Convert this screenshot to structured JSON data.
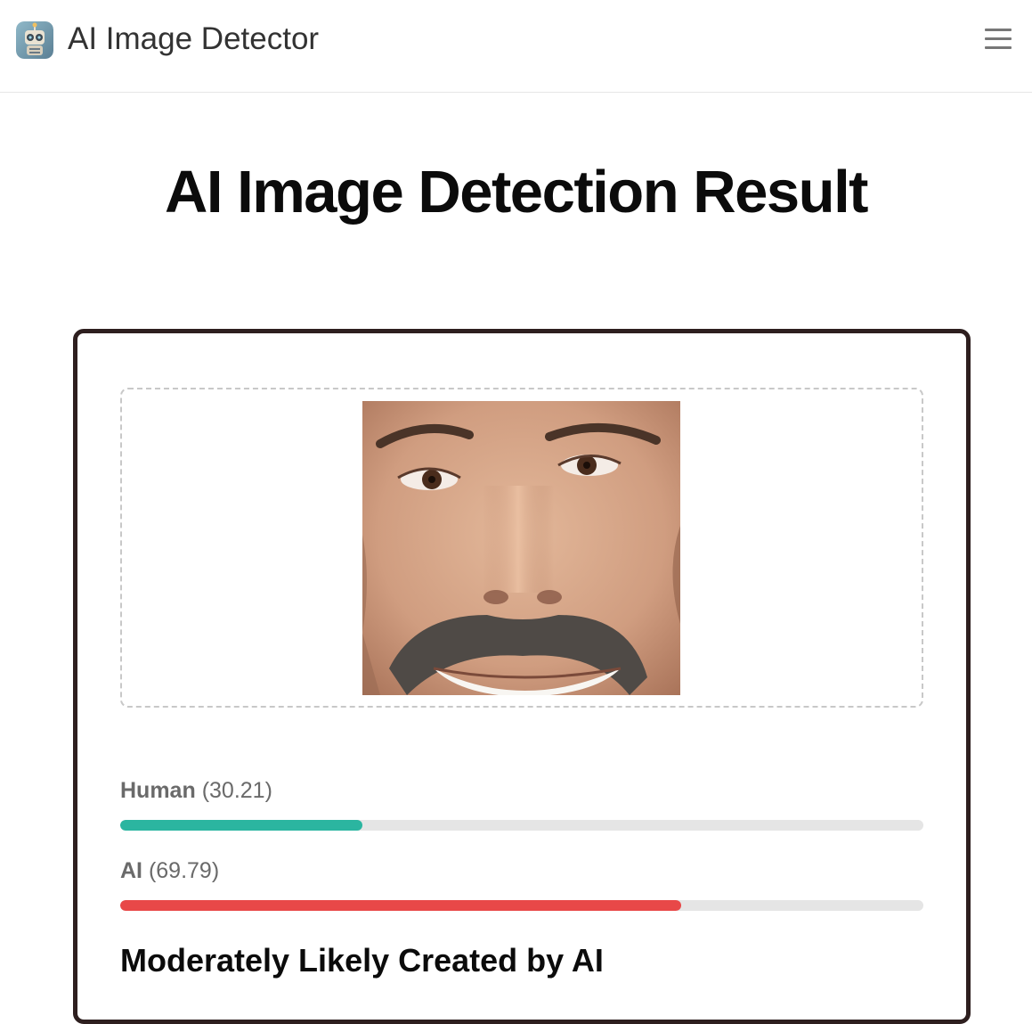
{
  "header": {
    "app_title": "AI Image Detector",
    "logo_icon": "robot-icon",
    "menu_icon": "hamburger-menu-icon"
  },
  "main": {
    "title": "AI Image Detection Result"
  },
  "result": {
    "image_alt": "Uploaded face photo",
    "scores": [
      {
        "label": "Human",
        "value": "(30.21)",
        "fraction": 0.3021,
        "color": "#2bb5a0"
      },
      {
        "label": "AI",
        "value": "(69.79)",
        "fraction": 0.6979,
        "color": "#e84848"
      }
    ],
    "verdict": "Moderately Likely Created by AI"
  }
}
